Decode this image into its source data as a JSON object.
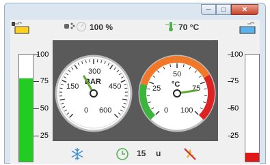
{
  "toolbar": {
    "humidity_value": "100 %",
    "temperature_value": "70  °C"
  },
  "pressure_gauge": {
    "unit": "BAR",
    "scale": [
      "0",
      "150",
      "300",
      "450",
      "600"
    ],
    "value": 235
  },
  "temp_gauge": {
    "unit": "°C",
    "scale": [
      "0",
      "25",
      "50",
      "75",
      "100"
    ],
    "value": 80
  },
  "left_tank": {
    "scale": [
      "100",
      "75",
      "50",
      "25"
    ],
    "level": 0.78,
    "fill_color": "#22cc22"
  },
  "right_tank": {
    "scale": [
      "100",
      "75",
      "50",
      "25"
    ],
    "level": 0.08,
    "fill_color": "#e01818"
  },
  "footer": {
    "counter_value": "15",
    "counter_unit": "u"
  }
}
